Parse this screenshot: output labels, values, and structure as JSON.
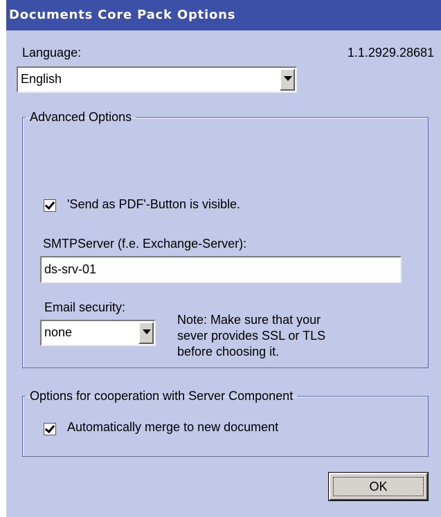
{
  "window": {
    "title": "Documents Core Pack Options"
  },
  "language": {
    "label": "Language:",
    "selected": "English"
  },
  "version": "1.1.2929.28681",
  "advanced": {
    "legend": "Advanced Options",
    "send_pdf": {
      "label": "'Send as PDF'-Button is visible.",
      "checked": true
    },
    "smtp": {
      "label": "SMTPServer (f.e. Exchange-Server):",
      "value": "ds-srv-01"
    },
    "email_security": {
      "label": "Email security:",
      "selected": "none"
    },
    "note": "Note: Make sure that your\nsever provides SSL or TLS\nbefore choosing it."
  },
  "server": {
    "legend": "Options for cooperation with Server Component",
    "merge": {
      "label": "Automatically merge to new document",
      "checked": true
    }
  },
  "buttons": {
    "ok": "OK"
  }
}
